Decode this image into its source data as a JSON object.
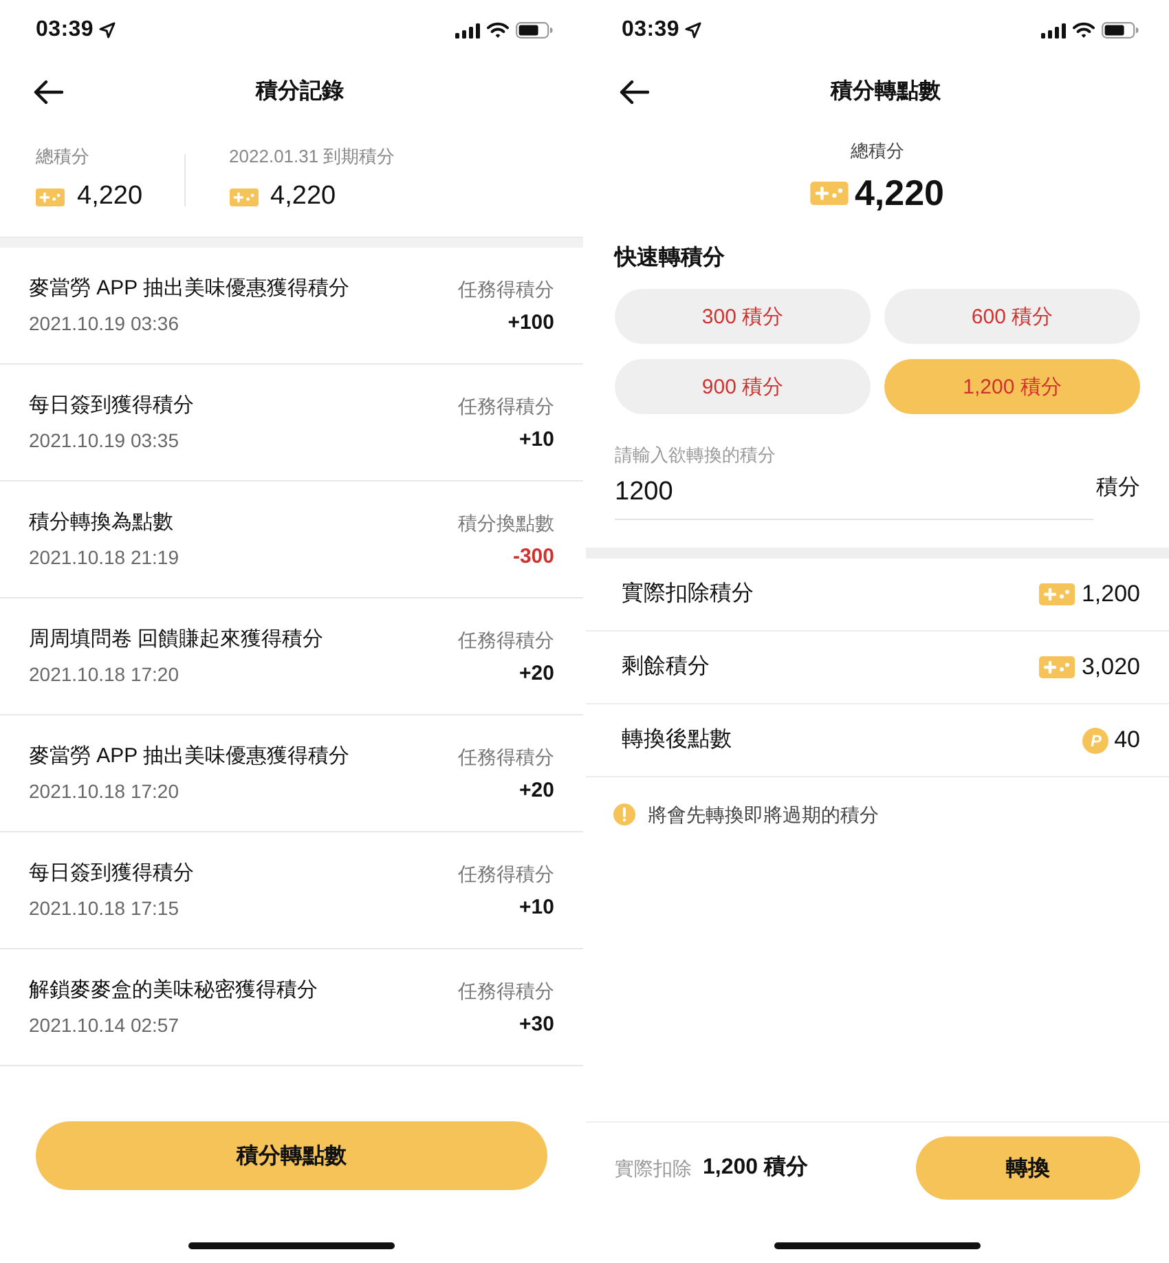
{
  "left_screen": {
    "status_bar": {
      "time": "03:39"
    },
    "title": "積分記錄",
    "summary": [
      {
        "label": "總積分",
        "value": "4,220"
      },
      {
        "label": "2022.01.31 到期積分",
        "value": "4,220"
      }
    ],
    "records": [
      {
        "title": "麥當勞 APP 抽出美味優惠獲得積分",
        "date": "2021.10.19 03:36",
        "category": "任務得積分",
        "amount": "+100",
        "kind": "credit"
      },
      {
        "title": "每日簽到獲得積分",
        "date": "2021.10.19 03:35",
        "category": "任務得積分",
        "amount": "+10",
        "kind": "credit"
      },
      {
        "title": "積分轉換為點數",
        "date": "2021.10.18 21:19",
        "category": "積分換點數",
        "amount": "-300",
        "kind": "debit"
      },
      {
        "title": "周周填問卷 回饋賺起來獲得積分",
        "date": "2021.10.18 17:20",
        "category": "任務得積分",
        "amount": "+20",
        "kind": "credit"
      },
      {
        "title": "麥當勞 APP 抽出美味優惠獲得積分",
        "date": "2021.10.18 17:20",
        "category": "任務得積分",
        "amount": "+20",
        "kind": "credit"
      },
      {
        "title": "每日簽到獲得積分",
        "date": "2021.10.18 17:15",
        "category": "任務得積分",
        "amount": "+10",
        "kind": "credit"
      },
      {
        "title": "解鎖麥麥盒的美味秘密獲得積分",
        "date": "2021.10.14 02:57",
        "category": "任務得積分",
        "amount": "+30",
        "kind": "credit"
      }
    ],
    "button": "積分轉點數"
  },
  "right_screen": {
    "status_bar": {
      "time": "03:39"
    },
    "title": "積分轉點數",
    "total": {
      "label": "總積分",
      "value": "4,220"
    },
    "quick": {
      "title": "快速轉積分",
      "options": [
        {
          "label": "300 積分",
          "selected": false
        },
        {
          "label": "600 積分",
          "selected": false
        },
        {
          "label": "900 積分",
          "selected": false
        },
        {
          "label": "1,200 積分",
          "selected": true
        }
      ]
    },
    "input": {
      "label": "請輸入欲轉換的積分",
      "value": "1200",
      "unit": "積分"
    },
    "details": [
      {
        "label": "實際扣除積分",
        "value": "1,200",
        "kind": "points"
      },
      {
        "label": "剩餘積分",
        "value": "3,020",
        "kind": "points"
      },
      {
        "label": "轉換後點數",
        "value": "40",
        "kind": "coins",
        "badge": "P"
      }
    ],
    "notice": "將會先轉換即將過期的積分",
    "footer": {
      "label": "實際扣除",
      "amount": "1,200 積分",
      "button": "轉換"
    }
  }
}
